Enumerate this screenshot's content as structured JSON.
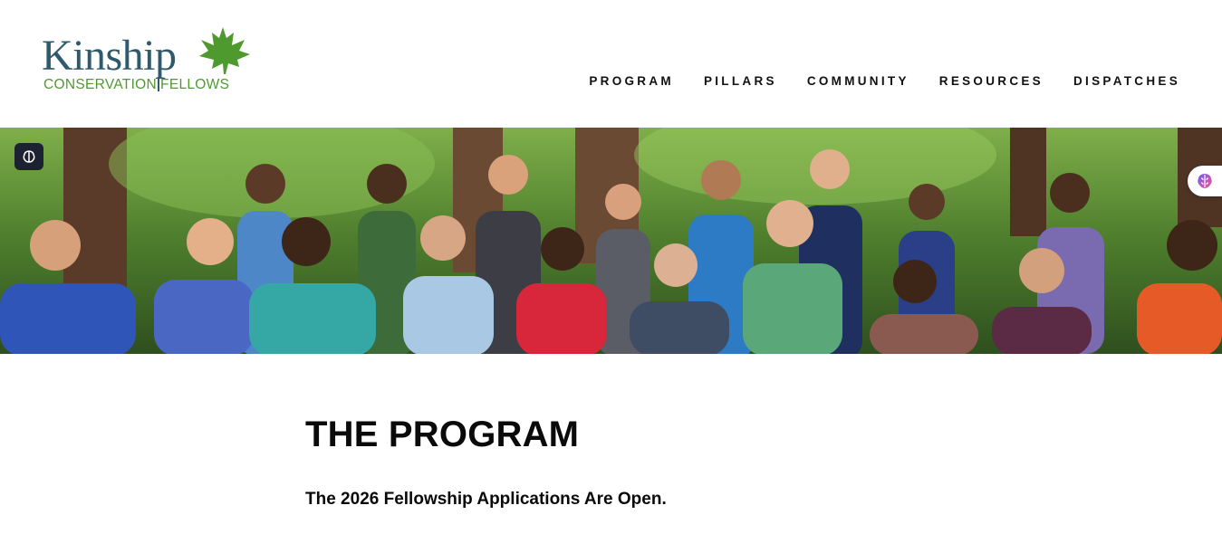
{
  "logo": {
    "wordmark": "Kinship",
    "sub_left": "CONSERVATION",
    "sub_right": "FELLOWS",
    "icon": "maple-leaf-icon",
    "colors": {
      "wordmark": "#2f5a6e",
      "sub": "#4f9a2f",
      "leaf": "#4f9a2f"
    }
  },
  "nav": {
    "items": [
      {
        "label": "PROGRAM"
      },
      {
        "label": "PILLARS"
      },
      {
        "label": "COMMUNITY"
      },
      {
        "label": "RESOURCES"
      },
      {
        "label": "DISPATCHES"
      }
    ]
  },
  "hero": {
    "image": "group-photo-of-fellows-in-forest",
    "overlay_buttons": [
      {
        "icon": "brain-icon"
      },
      {
        "icon": "brain-gradient-icon"
      }
    ]
  },
  "main": {
    "title": "THE PROGRAM",
    "subtitle": "The 2026 Fellowship Applications Are Open."
  }
}
